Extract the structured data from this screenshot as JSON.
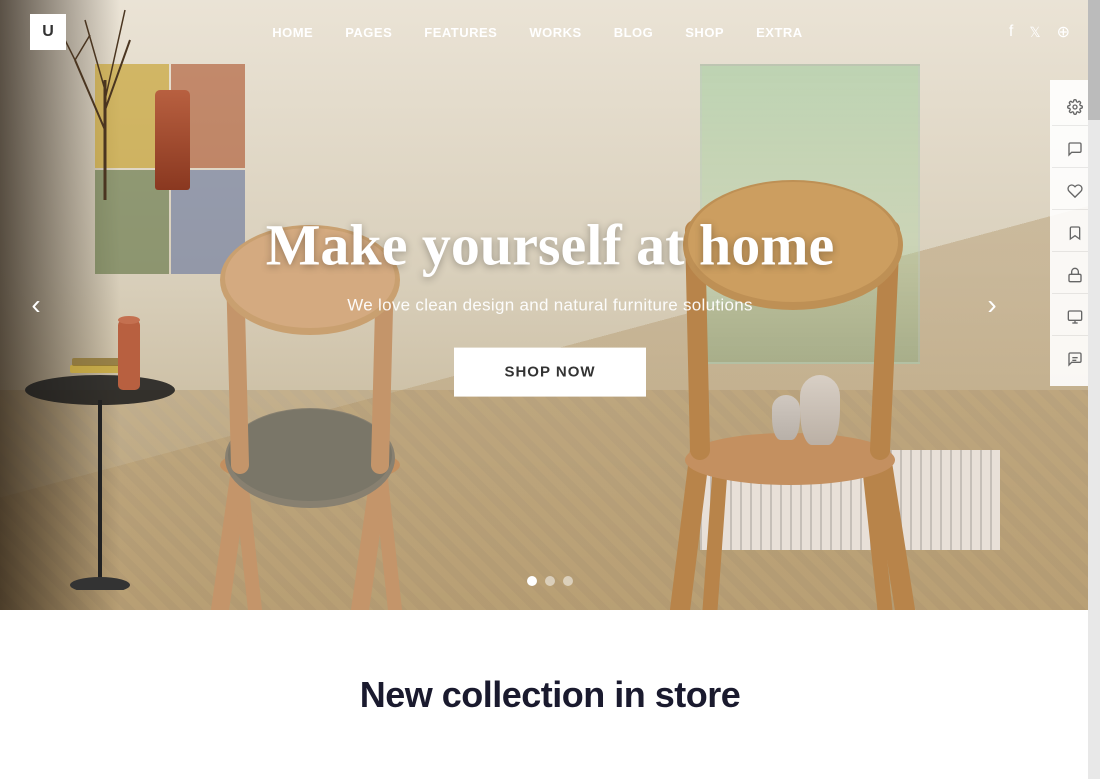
{
  "header": {
    "logo_text": "U",
    "nav_items": [
      {
        "label": "HOME",
        "id": "home"
      },
      {
        "label": "PAGES",
        "id": "pages"
      },
      {
        "label": "FEATURES",
        "id": "features"
      },
      {
        "label": "WORKS",
        "id": "works"
      },
      {
        "label": "BLOG",
        "id": "blog"
      },
      {
        "label": "SHOP",
        "id": "shop"
      },
      {
        "label": "EXTRA",
        "id": "extra"
      }
    ],
    "social_icons": [
      "facebook",
      "twitter",
      "settings"
    ]
  },
  "hero": {
    "title": "Make yourself at home",
    "subtitle": "We love clean design and natural furniture solutions",
    "cta_label": "Shop now",
    "arrow_left": "‹",
    "arrow_right": "›",
    "dots": [
      {
        "active": true
      },
      {
        "active": false
      },
      {
        "active": false
      }
    ]
  },
  "sidebar": {
    "icons": [
      {
        "name": "settings-icon",
        "symbol": "⚙"
      },
      {
        "name": "comment-icon",
        "symbol": "💬"
      },
      {
        "name": "heart-icon",
        "symbol": "♡"
      },
      {
        "name": "bookmark-icon",
        "symbol": "🔖"
      },
      {
        "name": "lock-icon",
        "symbol": "🔒"
      },
      {
        "name": "monitor-icon",
        "symbol": "🖥"
      },
      {
        "name": "chat-icon",
        "symbol": "💭"
      }
    ]
  },
  "bottom": {
    "title": "New collection in store"
  },
  "colors": {
    "accent": "#ffffff",
    "dark": "#1a1a2e",
    "nav_text": "#ffffff",
    "cta_bg": "#ffffff",
    "cta_text": "#333333"
  }
}
